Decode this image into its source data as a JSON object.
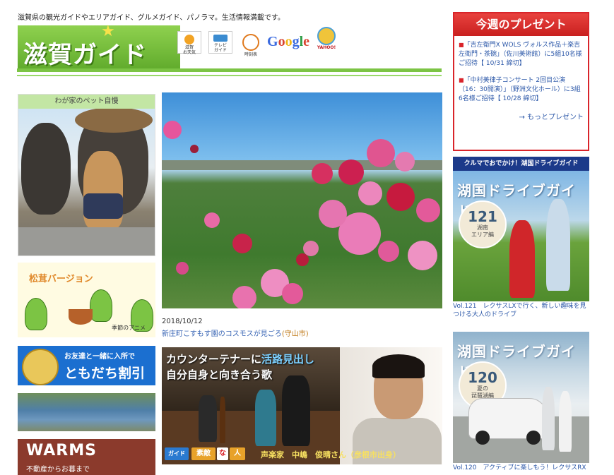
{
  "header": {
    "tagline": "滋賀県の観光ガイドやエリアガイド、グルメガイド、パノラマ。生活情報満載です。",
    "logo_text": "滋賀ガイド",
    "icons": [
      {
        "name": "weather-icon",
        "label": "滋賀\nお天気"
      },
      {
        "name": "tv-guide-icon",
        "label": "テレビ\nガイド"
      },
      {
        "name": "timetable-icon",
        "label": "時刻表"
      }
    ],
    "google_letters": [
      "G",
      "o",
      "o",
      "g",
      "l",
      "e"
    ],
    "yahoo_label": "YAHOO!"
  },
  "left": {
    "pet_title": "わが家のペット自慢",
    "matsutake_title": "松茸バージョン",
    "anime_caption": "季節のアニメ",
    "tomodachi_line1": "お友達と一緒に入所で",
    "tomodachi_line2": "ともだち割引",
    "warms_title": "WARMS",
    "warms_sub": "不動産からお暮まで"
  },
  "main": {
    "date": "2018/10/12",
    "caption": "新庄町こすもす園のコスモスが見ごろ",
    "location": "(守山市)",
    "feature": {
      "headline_a": "カウンターテナーに",
      "headline_hl": "活路見出し",
      "headline_b": "自分自身と向き合う歌",
      "badge_guide": "ガイド",
      "badge_suteki": "素敵",
      "badge_na": "な",
      "badge_hito": "人",
      "person": "声楽家　中嶋　俊晴さん（彦根市出身）"
    }
  },
  "present": {
    "title": "今週のプレゼント",
    "items": [
      "「吉左衛門X WOLS ヴォルス作品＋楽吉左衛門・茶碗」（佐川美術館）に5組10名様ご招待【 10/31 締切】",
      "「中村美律子コンサート 2回目公演（16：30開演）」（野洲文化ホール）に3組6名様ご招待【 10/28 締切】"
    ],
    "more": "→ もっとプレゼント"
  },
  "drive": {
    "header": "クルマでおでかけ！湖国ドライブガイド",
    "title": "湖国ドライブガイド",
    "vol1": {
      "number": "121",
      "sub": "湖南\nエリア編",
      "caption": "Vol.121　レクサスLXで行く、新しい趣味を見つける大人のドライブ"
    },
    "vol2": {
      "number": "120",
      "sub": "夏の\n琵琶湖編",
      "caption": "Vol.120　アクティブに楽しもう！レクサスRX"
    }
  },
  "colors": {
    "brand_green": "#7cc444",
    "present_red": "#d9242a",
    "link_blue": "#2b57a8",
    "drive_navy": "#1c3a8a"
  }
}
